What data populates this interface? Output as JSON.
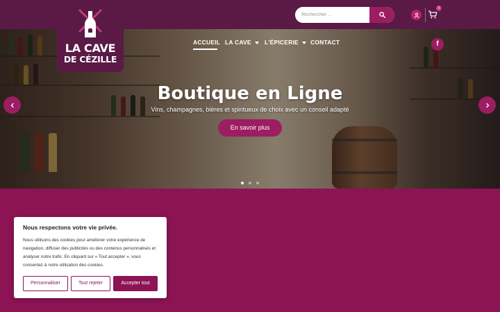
{
  "header": {
    "search": {
      "placeholder": "Rechercher ...",
      "value": ""
    },
    "cart_count": "0"
  },
  "logo": {
    "line1": "LA CAVE",
    "line2": "DE CÉZILLE"
  },
  "nav": [
    {
      "label": "ACCUEIL",
      "active": true
    },
    {
      "label": "LA CAVE",
      "has_dropdown": true
    },
    {
      "label": "L'ÉPICERIE",
      "has_dropdown": true
    },
    {
      "label": "CONTACT"
    }
  ],
  "social": {
    "facebook_glyph": "f"
  },
  "hero": {
    "title": "Boutique en Ligne",
    "subtitle": "Vins, champagnes, bières et spiritueux de choix avec un conseil adapté",
    "cta": "En savoir plus",
    "slide_count": 3,
    "active_slide": 1
  },
  "cookie_banner": {
    "title": "Nous respectons votre vie privée.",
    "text": "Nous utilisons des cookies pour améliorer votre expérience de navigation, diffuser des publicités ou des contenus personnalisés et analyser notre trafic. En cliquant sur « Tout accepter », vous consentez à notre utilisation des cookies.",
    "buttons": {
      "customize": "Personnaliser",
      "reject": "Tout rejeter",
      "accept": "Accepter tout"
    }
  },
  "colors": {
    "brand": "#8c1455",
    "brand_dark": "#5a1a45",
    "accent": "#9c1d62"
  },
  "icons": [
    "search-icon",
    "user-icon",
    "cart-icon",
    "facebook-icon",
    "chevron-left-icon",
    "chevron-right-icon",
    "bottle-windmill-logo-icon"
  ]
}
